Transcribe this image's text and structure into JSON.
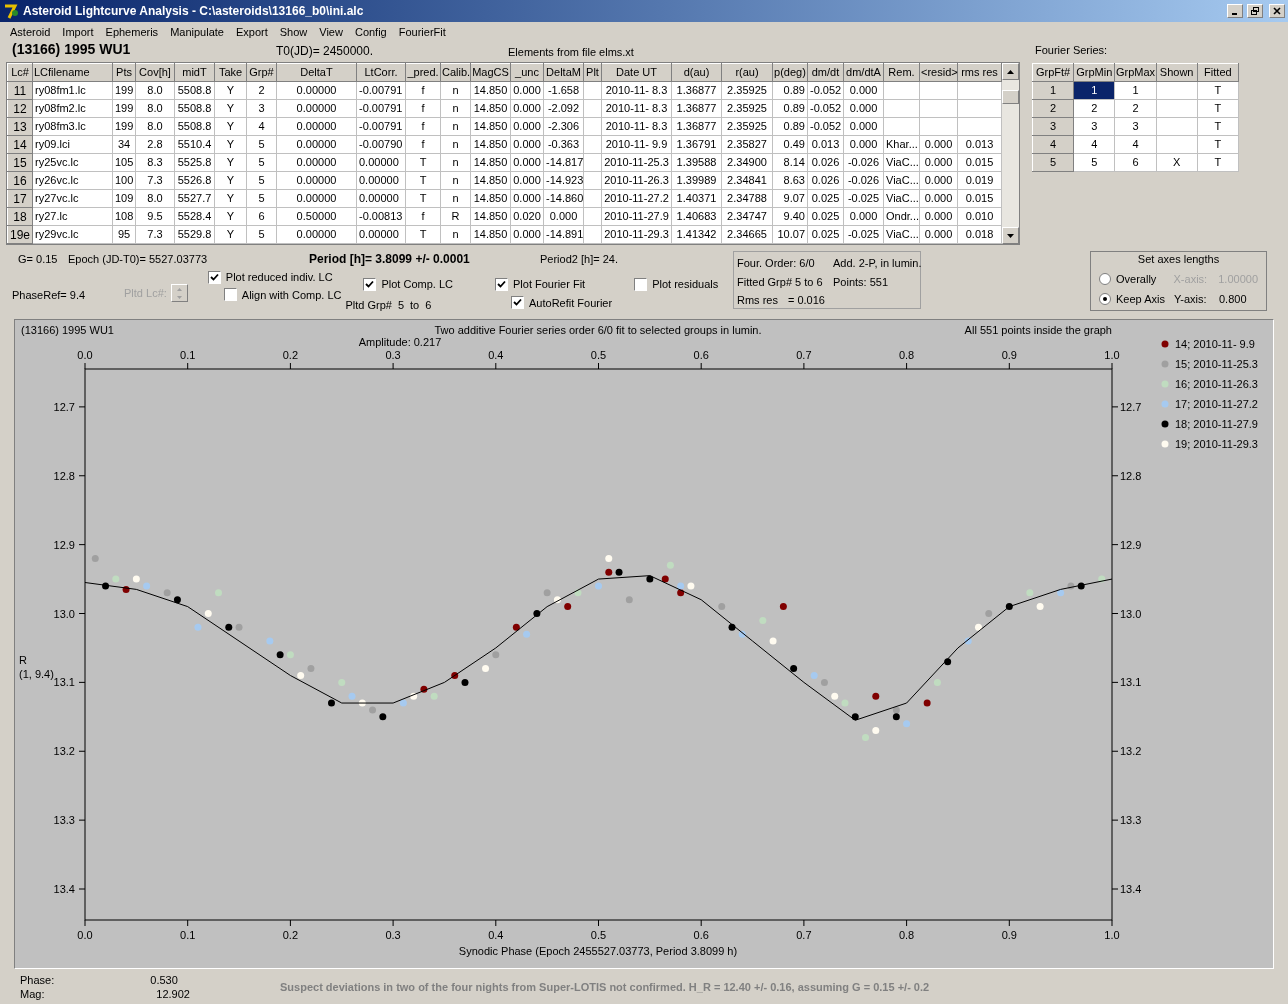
{
  "window": {
    "title": "Asteroid Lightcurve Analysis - C:\\asteroids\\13166_b0\\ini.alc"
  },
  "menu": [
    "Asteroid",
    "Import",
    "Ephemeris",
    "Manipulate",
    "Export",
    "Show",
    "View",
    "Config",
    "FourierFit"
  ],
  "asteroid": "(13166) 1995 WU1",
  "t0": "T0(JD)= 2450000.",
  "elements_note": "Elements from file elms.xt",
  "lc_table": {
    "columns": [
      "Lc#",
      "LCfilename",
      "Pts",
      "Cov[h]",
      "midT",
      "Take",
      "Grp#",
      "DeltaT",
      "LtCorr.",
      "_pred.",
      "Calib.",
      "MagCS",
      "_unc",
      "DeltaM",
      "Plt",
      "Date UT",
      "d(au)",
      "r(au)",
      "p(deg)",
      "dm/dt",
      "dm/dtA",
      "Rem.",
      "<resid>",
      "rms res"
    ],
    "rows": [
      {
        "cells": [
          "11",
          "ry08fm1.lc",
          "199",
          "8.0",
          "5508.8",
          "Y",
          "2",
          "0.00000",
          "-0.00791",
          "f",
          "n",
          "14.850",
          "0.000",
          "-1.658",
          null,
          "2010-11- 8.3",
          "1.36877",
          "2.35925",
          "0.89",
          "-0.052",
          "0.000",
          null,
          null,
          null
        ]
      },
      {
        "cells": [
          "12",
          "ry08fm2.lc",
          "199",
          "8.0",
          "5508.8",
          "Y",
          "3",
          "0.00000",
          "-0.00791",
          "f",
          "n",
          "14.850",
          "0.000",
          "-2.092",
          null,
          "2010-11- 8.3",
          "1.36877",
          "2.35925",
          "0.89",
          "-0.052",
          "0.000",
          null,
          null,
          null
        ]
      },
      {
        "cells": [
          "13",
          "ry08fm3.lc",
          "199",
          "8.0",
          "5508.8",
          "Y",
          "4",
          "0.00000",
          "-0.00791",
          "f",
          "n",
          "14.850",
          "0.000",
          "-2.306",
          null,
          "2010-11- 8.3",
          "1.36877",
          "2.35925",
          "0.89",
          "-0.052",
          "0.000",
          null,
          null,
          null
        ]
      },
      {
        "cells": [
          "14",
          "ry09.lci",
          "34",
          "2.8",
          "5510.4",
          "Y",
          "5",
          "0.00000",
          "-0.00790",
          "f",
          "n",
          "14.850",
          "0.000",
          "-0.363",
          null,
          "2010-11- 9.9",
          "1.36791",
          "2.35827",
          "0.49",
          "0.013",
          "0.000",
          "Khar...",
          "0.000",
          "0.013"
        ]
      },
      {
        "cells": [
          "15",
          "ry25vc.lc",
          "105",
          "8.3",
          "5525.8",
          "Y",
          "5",
          "0.00000",
          "0.00000",
          "T",
          "n",
          "14.850",
          "0.000",
          "-14.817",
          null,
          "2010-11-25.3",
          "1.39588",
          "2.34900",
          "8.14",
          "0.026",
          "-0.026",
          "ViaC...",
          "0.000",
          "0.015"
        ]
      },
      {
        "cells": [
          "16",
          "ry26vc.lc",
          "100",
          "7.3",
          "5526.8",
          "Y",
          "5",
          "0.00000",
          "0.00000",
          "T",
          "n",
          "14.850",
          "0.000",
          "-14.923",
          null,
          "2010-11-26.3",
          "1.39989",
          "2.34841",
          "8.63",
          "0.026",
          "-0.026",
          "ViaC...",
          "0.000",
          "0.019"
        ]
      },
      {
        "cells": [
          "17",
          "ry27vc.lc",
          "109",
          "8.0",
          "5527.7",
          "Y",
          "5",
          "0.00000",
          "0.00000",
          "T",
          "n",
          "14.850",
          "0.000",
          "-14.860",
          null,
          "2010-11-27.2",
          "1.40371",
          "2.34788",
          "9.07",
          "0.025",
          "-0.025",
          "ViaC...",
          "0.000",
          "0.015"
        ]
      },
      {
        "cells": [
          "18",
          "ry27.lc",
          "108",
          "9.5",
          "5528.4",
          "Y",
          "6",
          "0.50000",
          "-0.00813",
          "f",
          "R",
          "14.850",
          "0.020",
          "0.000",
          null,
          "2010-11-27.9",
          "1.40683",
          "2.34747",
          "9.40",
          "0.025",
          "0.000",
          "Ondr...",
          "0.000",
          "0.010"
        ]
      },
      {
        "cells": [
          "19e",
          "ry29vc.lc",
          "95",
          "7.3",
          "5529.8",
          "Y",
          "5",
          "0.00000",
          "0.00000",
          "T",
          "n",
          "14.850",
          "0.000",
          "-14.891",
          null,
          "2010-11-29.3",
          "1.41342",
          "2.34665",
          "10.07",
          "0.025",
          "-0.025",
          "ViaC...",
          "0.000",
          "0.018"
        ]
      }
    ]
  },
  "fourier": {
    "label": "Fourier Series:",
    "columns": [
      "GrpFt#",
      "GrpMin",
      "GrpMax",
      "Shown",
      "Fitted"
    ],
    "rows": [
      {
        "grpft": "1",
        "grpmin": "1",
        "grpmin_selected": true,
        "grpmax": "1",
        "fitted": "T"
      },
      {
        "grpft": "2",
        "grpmin": "2",
        "grpmin_selected": false,
        "grpmax": "2",
        "fitted": "T"
      },
      {
        "grpft": "3",
        "grpmin": "3",
        "grpmin_selected": false,
        "grpmax": "3",
        "fitted": "T"
      },
      {
        "grpft": "4",
        "grpmin": "4",
        "grpmin_selected": false,
        "grpmax": "4",
        "fitted": "T"
      },
      {
        "grpft": "5",
        "grpmin": "5",
        "grpmin_selected": false,
        "grpmax": "6",
        "shown": "X",
        "fitted": "T"
      }
    ]
  },
  "info": {
    "g": "G= 0.15",
    "epoch": "Epoch (JD-T0)= 5527.03773",
    "period": "Period [h]= 3.8099 +/- 0.0001",
    "period2": "Period2 [h]= 24.",
    "phase_ref": "PhaseRef= 9.4",
    "pltd_lc": {
      "label": "Pltd Lc#:",
      "disabled": true
    }
  },
  "options": [
    {
      "label": "Plot reduced indiv. LC",
      "checked": true
    },
    {
      "label": "Align with Comp. LC",
      "checked": false
    },
    {
      "label": "Plot Comp. LC",
      "checked": true
    },
    {
      "label": "Plot Fourier Fit",
      "checked": true
    },
    {
      "label": "AutoRefit Fourier",
      "checked": true
    },
    {
      "label": "Plot residuals",
      "checked": false
    }
  ],
  "pltd_grp": {
    "label": "Pltd Grp#",
    "from": "5",
    "to_label": "to",
    "to": "6"
  },
  "fit_summary": {
    "order": "Four. Order:  6/0",
    "mode": "Add. 2-P, in lumin.",
    "fitted": "Fitted Grp# 5 to 6",
    "points": "Points: 551",
    "rms_label": "Rms res",
    "rms_value": "= 0.016"
  },
  "axes": {
    "title": "Set axes lengths",
    "radios": [
      {
        "label": "Overally",
        "selected": false
      },
      {
        "label": "Keep Axis",
        "selected": true
      }
    ],
    "x_axis": {
      "label": "X-axis:",
      "value": "1.00000",
      "disabled": true
    },
    "y_axis": {
      "label": "Y-axis:",
      "value": "0.800",
      "disabled": false
    }
  },
  "chart": {
    "header_left": "(13166) 1995 WU1",
    "amplitude": "Amplitude: 0.217",
    "header_right": "All 551 points inside the graph",
    "ylabel_note": "(1, 9.4)",
    "chart_data": {
      "type": "scatter",
      "title": "Two additive Fourier series order 6/0 fit to selected groups in lumin.",
      "xlabel": "Synodic Phase (Epoch 2455527.03773, Period 3.8099 h)",
      "ylabel": "R",
      "legend": "right",
      "xlim": [
        0,
        1
      ],
      "ylim": [
        13.445,
        12.645
      ],
      "xticks": [
        {
          "value": 0,
          "label": "0.0"
        },
        {
          "value": 0.1,
          "label": "0.1"
        },
        {
          "value": 0.2,
          "label": "0.2"
        },
        {
          "value": 0.3,
          "label": "0.3"
        },
        {
          "value": 0.4,
          "label": "0.4"
        },
        {
          "value": 0.5,
          "label": "0.5"
        },
        {
          "value": 0.6,
          "label": "0.6"
        },
        {
          "value": 0.7,
          "label": "0.7"
        },
        {
          "value": 0.8,
          "label": "0.8"
        },
        {
          "value": 0.9,
          "label": "0.9"
        },
        {
          "value": 1,
          "label": "1.0"
        }
      ],
      "yticks": [
        {
          "value": 12.7,
          "label": "12.7"
        },
        {
          "value": 12.8,
          "label": "12.8"
        },
        {
          "value": 12.9,
          "label": "12.9"
        },
        {
          "value": 13.0,
          "label": "13.0"
        },
        {
          "value": 13.1,
          "label": "13.1"
        },
        {
          "value": 13.2,
          "label": "13.2"
        },
        {
          "value": 13.3,
          "label": "13.3"
        },
        {
          "value": 13.4,
          "label": "13.4"
        }
      ],
      "series": [
        {
          "name": "14; 2010-11- 9.9",
          "color": "#800000",
          "x": [
            0.04,
            0.33,
            0.36,
            0.42,
            0.47,
            0.51,
            0.565,
            0.58,
            0.68,
            0.77,
            0.82
          ],
          "values": [
            12.965,
            13.11,
            13.09,
            13.02,
            12.99,
            12.94,
            12.95,
            12.97,
            12.99,
            13.12,
            13.13
          ]
        },
        {
          "name": "15; 2010-11-25.3",
          "color": "#a0a0a0",
          "x": [
            0.01,
            0.08,
            0.15,
            0.22,
            0.28,
            0.4,
            0.45,
            0.53,
            0.62,
            0.72,
            0.79,
            0.88,
            0.96
          ],
          "values": [
            12.92,
            12.97,
            13.02,
            13.08,
            13.14,
            13.06,
            12.97,
            12.98,
            12.99,
            13.1,
            13.14,
            13.0,
            12.96
          ]
        },
        {
          "name": "16; 2010-11-26.3",
          "color": "#c0dcc0",
          "x": [
            0.03,
            0.13,
            0.2,
            0.25,
            0.34,
            0.48,
            0.57,
            0.66,
            0.74,
            0.76,
            0.83,
            0.92,
            0.99
          ],
          "values": [
            12.95,
            12.97,
            13.06,
            13.1,
            13.12,
            12.97,
            12.93,
            13.01,
            13.13,
            13.18,
            13.1,
            12.97,
            12.95
          ]
        },
        {
          "name": "17; 2010-11-27.2",
          "color": "#a6caf0",
          "x": [
            0.06,
            0.11,
            0.18,
            0.26,
            0.31,
            0.43,
            0.5,
            0.58,
            0.64,
            0.71,
            0.8,
            0.86,
            0.95
          ],
          "values": [
            12.96,
            13.02,
            13.04,
            13.12,
            13.13,
            13.03,
            12.96,
            12.96,
            13.03,
            13.09,
            13.16,
            13.04,
            12.97
          ]
        },
        {
          "name": "18; 2010-11-27.9",
          "color": "#000000",
          "x": [
            0.02,
            0.09,
            0.14,
            0.19,
            0.24,
            0.29,
            0.37,
            0.44,
            0.52,
            0.55,
            0.63,
            0.69,
            0.75,
            0.79,
            0.84,
            0.9,
            0.97
          ],
          "values": [
            12.96,
            12.98,
            13.02,
            13.06,
            13.13,
            13.15,
            13.1,
            13.0,
            12.94,
            12.95,
            13.02,
            13.08,
            13.15,
            13.15,
            13.07,
            12.99,
            12.96
          ]
        },
        {
          "name": "19; 2010-11-29.3",
          "color": "#fffbf0",
          "x": [
            0.05,
            0.12,
            0.21,
            0.27,
            0.32,
            0.39,
            0.46,
            0.51,
            0.59,
            0.67,
            0.73,
            0.77,
            0.87,
            0.93
          ],
          "values": [
            12.95,
            13.0,
            13.09,
            13.13,
            13.12,
            13.08,
            12.98,
            12.92,
            12.96,
            13.04,
            13.12,
            13.17,
            13.02,
            12.99
          ]
        },
        {
          "type": "line",
          "color": "#000000",
          "x": [
            0,
            0.05,
            0.1,
            0.15,
            0.2,
            0.25,
            0.3,
            0.35,
            0.4,
            0.45,
            0.5,
            0.55,
            0.6,
            0.65,
            0.7,
            0.75,
            0.8,
            0.85,
            0.9,
            0.95,
            1
          ],
          "values": [
            12.955,
            12.965,
            12.99,
            13.04,
            13.09,
            13.13,
            13.13,
            13.1,
            13.05,
            12.99,
            12.95,
            12.945,
            12.98,
            13.04,
            13.1,
            13.155,
            13.13,
            13.05,
            12.99,
            12.965,
            12.95
          ]
        }
      ]
    }
  },
  "footer": {
    "phase_label": "Phase:",
    "phase": "0.530",
    "mag_label": "Mag:",
    "mag": "12.902",
    "note": "Suspect deviations in two of the four nights from Super-LOTIS not confirmed. H_R = 12.40 +/- 0.16, assuming G = 0.15 +/- 0.2"
  }
}
